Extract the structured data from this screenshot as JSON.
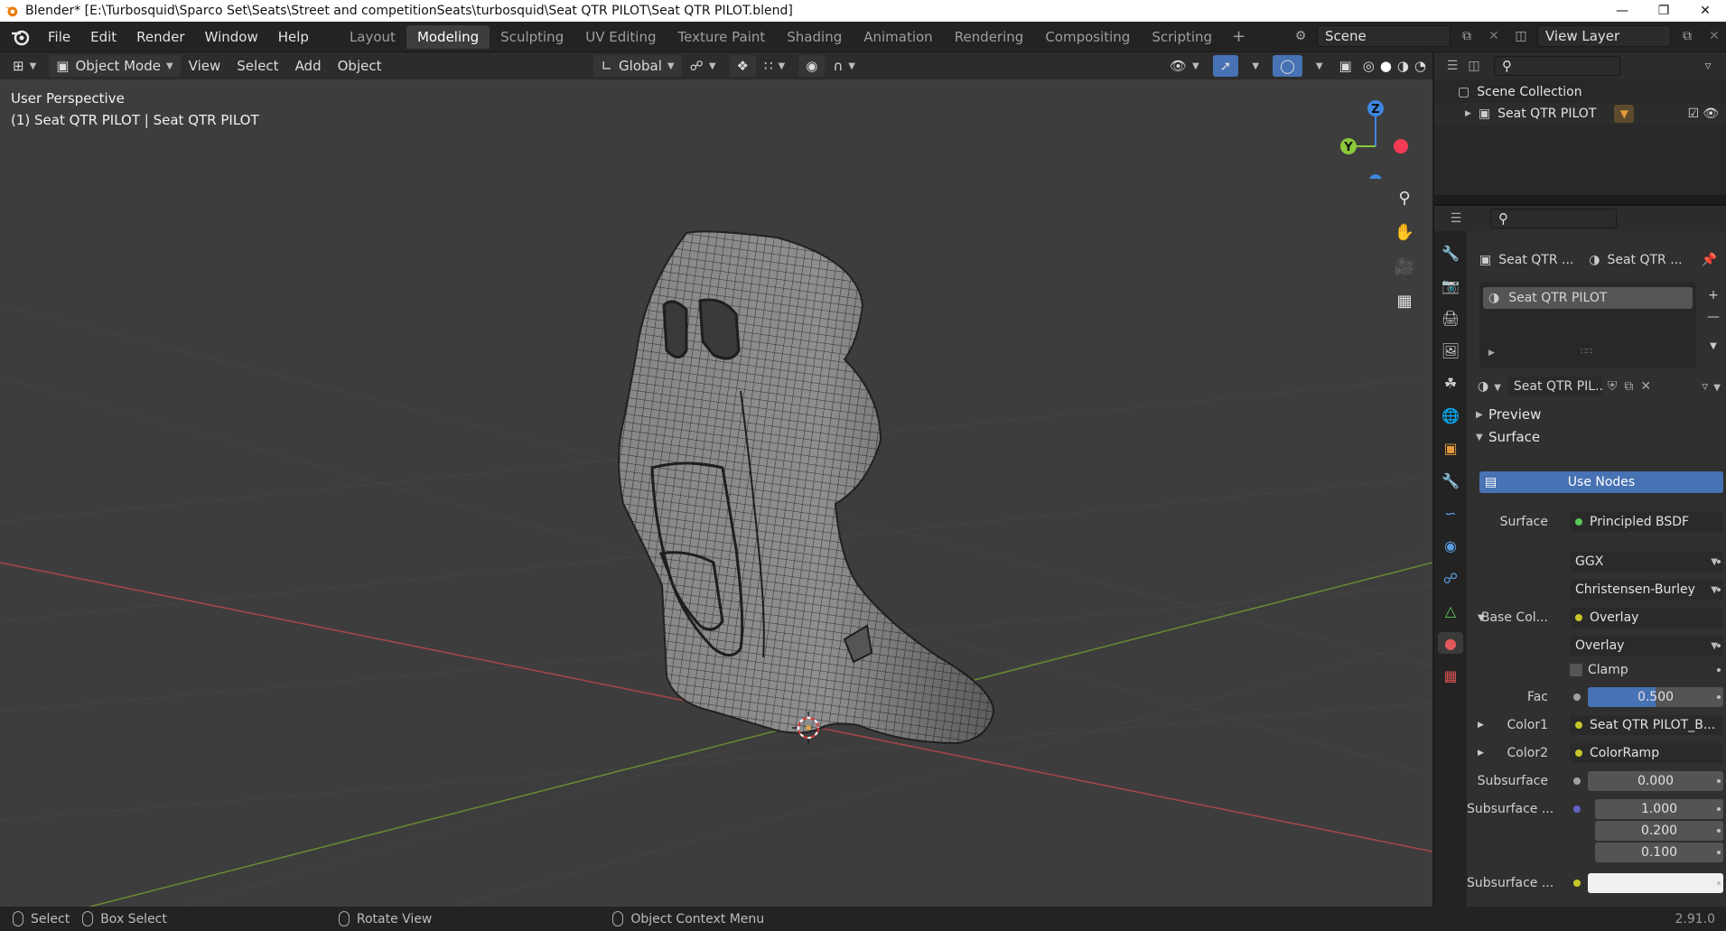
{
  "titlebar": {
    "title": "Blender* [E:\\Turbosquid\\Sparco Set\\Seats\\Street and competitionSeats\\turbosquid\\Seat QTR PILOT\\Seat QTR PILOT.blend]",
    "minimize": "—",
    "maximize": "❐",
    "close": "✕"
  },
  "menu": [
    "File",
    "Edit",
    "Render",
    "Window",
    "Help"
  ],
  "workspaces": [
    "Layout",
    "Modeling",
    "Sculpting",
    "UV Editing",
    "Texture Paint",
    "Shading",
    "Animation",
    "Rendering",
    "Compositing",
    "Scripting"
  ],
  "active_workspace": "Modeling",
  "scene": {
    "name": "Scene",
    "view_layer": "View Layer"
  },
  "viewport_header": {
    "mode": "Object Mode",
    "menus": [
      "View",
      "Select",
      "Add",
      "Object"
    ],
    "transform_orientation": "Global"
  },
  "viewport": {
    "perspective": "User Perspective",
    "object_label": "(1) Seat QTR PILOT | Seat QTR PILOT",
    "gizmo": {
      "z": "Z",
      "y": "Y"
    }
  },
  "outliner": {
    "scene_collection": "Scene Collection",
    "object": "Seat QTR PILOT"
  },
  "properties": {
    "breadcrumb_object": "Seat QTR ...",
    "breadcrumb_material": "Seat QTR ...",
    "material_slot": "Seat QTR PILOT",
    "material_name": "Seat QTR PIL...",
    "sections": {
      "preview": "Preview",
      "surface": "Surface"
    },
    "use_nodes": "Use Nodes",
    "rows": {
      "surface_label": "Surface",
      "surface_value": "Principled BSDF",
      "distribution": "GGX",
      "subsurface_method": "Christensen-Burley",
      "base_color_label": "Base Col...",
      "base_color_value": "Overlay",
      "blend_mode": "Overlay",
      "clamp": "Clamp",
      "fac_label": "Fac",
      "fac_value": "0.500",
      "fac": 0.5,
      "color1_label": "Color1",
      "color1_value": "Seat QTR PILOT_B...",
      "color2_label": "Color2",
      "color2_value": "ColorRamp",
      "subsurface_label": "Subsurface",
      "subsurface_value": "0.000",
      "subsurface_radius_label": "Subsurface ...",
      "radius_x": "1.000",
      "radius_y": "0.200",
      "radius_z": "0.100",
      "subsurface_color_label": "Subsurface ..."
    }
  },
  "statusbar": {
    "select": "Select",
    "box_select": "Box Select",
    "rotate": "Rotate View",
    "context_menu": "Object Context Menu",
    "version": "2.91.0"
  },
  "colors": {
    "accent_blue": "#4772b3",
    "gizmo_x": "#f53a56",
    "gizmo_y": "#8bc83a",
    "gizmo_z": "#3d87e0",
    "axis_red": "#a84646",
    "axis_green": "#6a8a32"
  }
}
